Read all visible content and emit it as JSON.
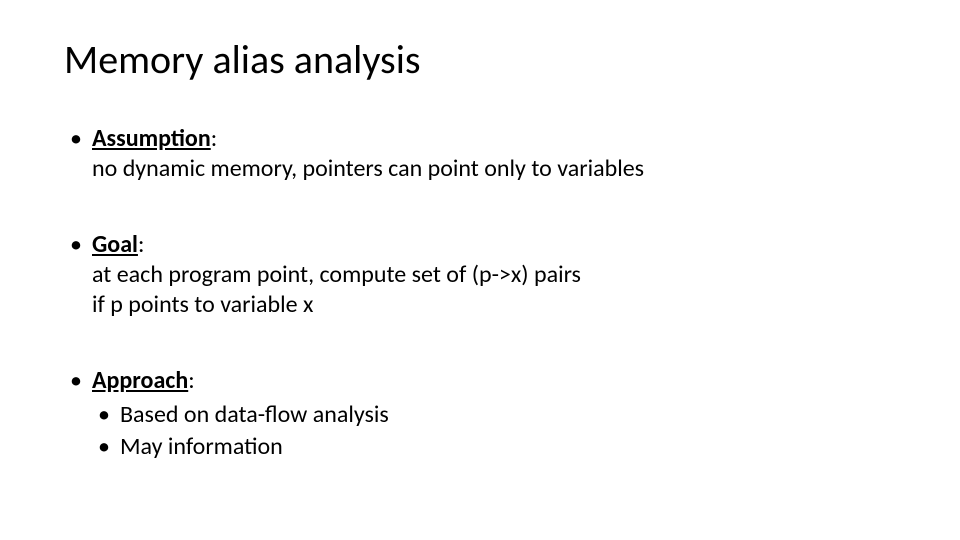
{
  "title": "Memory alias analysis",
  "bullets": [
    {
      "header": "Assumption",
      "body": "no dynamic memory, pointers can point only to variables"
    },
    {
      "header": "Goal",
      "body": "at each program point, compute set of (p->x) pairs\nif p points to variable x"
    },
    {
      "header": "Approach",
      "sub": [
        "Based on data-flow analysis",
        "May information"
      ]
    }
  ],
  "colon": ":"
}
